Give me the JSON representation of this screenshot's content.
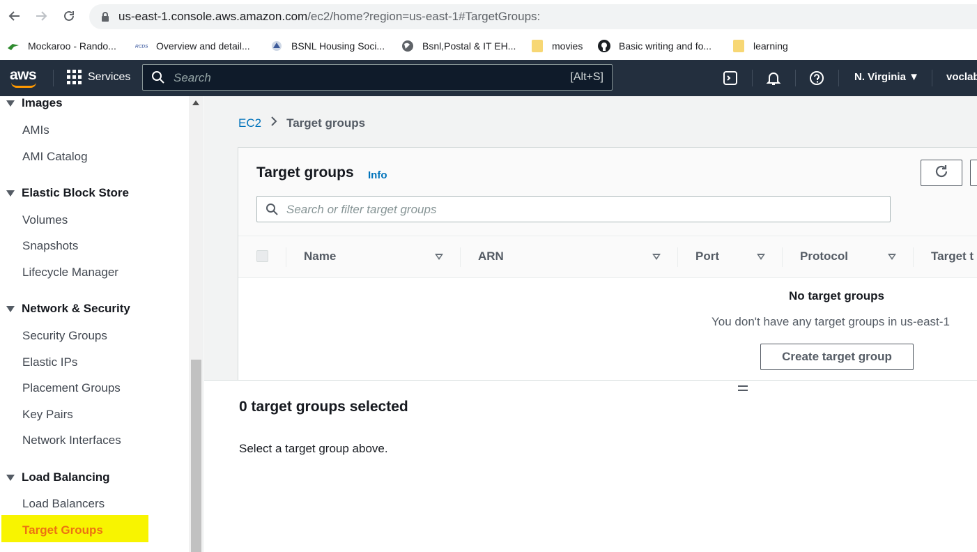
{
  "browser": {
    "url_host": "us-east-1.console.aws.amazon.com",
    "url_path": "/ec2/home?region=us-east-1#TargetGroups:",
    "bookmarks": [
      {
        "label": "Mockaroo - Rando...",
        "icon": "mockaroo-icon"
      },
      {
        "label": "Overview and detail...",
        "icon": "site-icon"
      },
      {
        "label": "BSNL Housing Soci...",
        "icon": "site-icon"
      },
      {
        "label": "Bsnl,Postal & IT EH...",
        "icon": "globe-icon"
      },
      {
        "label": "movies",
        "icon": "folder-icon"
      },
      {
        "label": "Basic writing and fo...",
        "icon": "github-icon"
      },
      {
        "label": "learning",
        "icon": "folder-icon"
      }
    ]
  },
  "aws_nav": {
    "logo": "aws",
    "services": "Services",
    "search_placeholder": "Search",
    "search_shortcut": "[Alt+S]",
    "region": "N. Virginia",
    "account": "voclab"
  },
  "sidebar": {
    "sections": [
      {
        "title": "Images",
        "items": [
          "AMIs",
          "AMI Catalog"
        ]
      },
      {
        "title": "Elastic Block Store",
        "items": [
          "Volumes",
          "Snapshots",
          "Lifecycle Manager"
        ]
      },
      {
        "title": "Network & Security",
        "items": [
          "Security Groups",
          "Elastic IPs",
          "Placement Groups",
          "Key Pairs",
          "Network Interfaces"
        ]
      },
      {
        "title": "Load Balancing",
        "items": [
          "Load Balancers",
          "Target Groups"
        ]
      }
    ],
    "active_item": "Target Groups"
  },
  "main": {
    "breadcrumb": {
      "root": "EC2",
      "current": "Target groups"
    },
    "panel": {
      "title": "Target groups",
      "info": "Info",
      "filter_placeholder": "Search or filter target groups",
      "columns": [
        "Name",
        "ARN",
        "Port",
        "Protocol",
        "Target t"
      ],
      "empty_title": "No target groups",
      "empty_sub": "You don't have any target groups in us-east-1",
      "create_button": "Create target group"
    },
    "split": {
      "title": "0 target groups selected",
      "subtitle": "Select a target group above."
    }
  },
  "colors": {
    "aws_nav_bg": "#232f3e",
    "link": "#0073bb",
    "active_nav": "#ec7211",
    "highlight": "#f8f400"
  }
}
